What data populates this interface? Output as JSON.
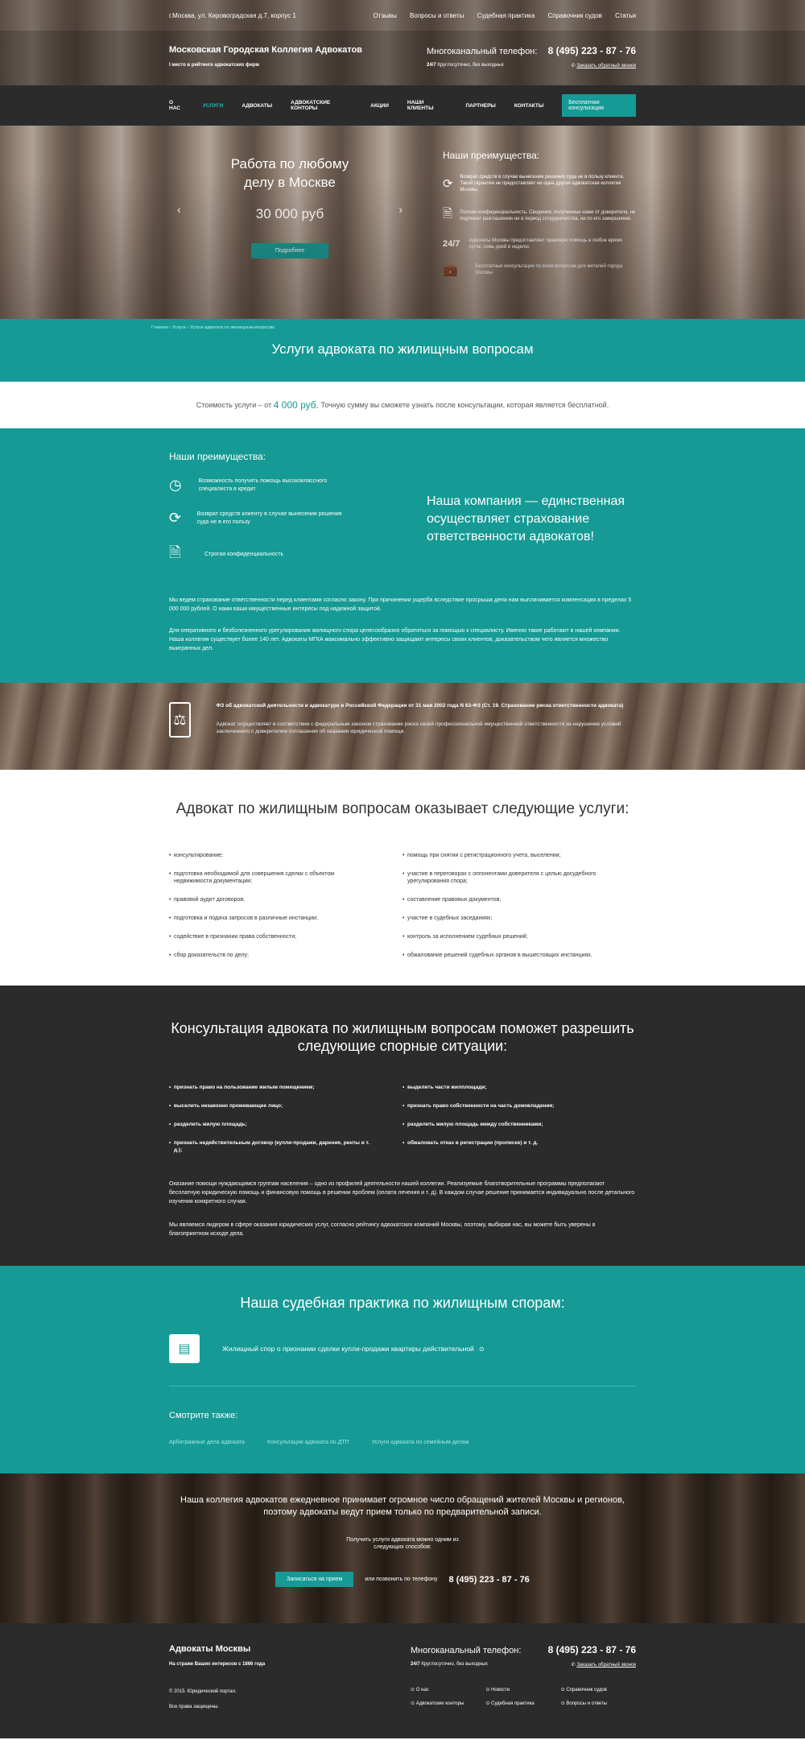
{
  "topbar": {
    "address": "г.Москва, ул. Кировоградская д.7, корпус 1",
    "links": [
      "Отзывы",
      "Вопросы и ответы",
      "Судебная практика",
      "Справочник судов",
      "Статьи"
    ]
  },
  "brand": {
    "title": "Московская Городская Коллегия Адвокатов",
    "subtitle": "I место в рейтинге адвокатских фирм",
    "phone_label": "Многоканальный телефон:",
    "phone": "8 (495) 223 - 87 - 76",
    "hours_bold": "24/7",
    "hours_text": "Круглосуточно, без выходных",
    "callback": "Заказать обратный звонок"
  },
  "nav": {
    "items": [
      "О НАС",
      "УСЛУГИ",
      "АДВОКАТЫ",
      "АДВОКАТСКИЕ КОНТОРЫ",
      "АКЦИИ",
      "НАШИ КЛИЕНТЫ",
      "ПАРТНЕРЫ",
      "КОНТАКТЫ"
    ],
    "cta": "Бесплатная консультация"
  },
  "hero": {
    "title": "Работа по любому делу в Москве",
    "price": "30 000 руб",
    "button": "Подробнее",
    "adv_title": "Наши преимущества:",
    "advantages": [
      {
        "icon": "refresh-icon",
        "text": "Возврат средств в случае вынесения решения суда не в пользу клиента. Такой гарантии не предоставляет ни одна другая адвокатская коллегия Москвы."
      },
      {
        "icon": "document-lock-icon",
        "text": "Полная конфиденциальность. Сведения, полученные нами от доверителя, не подлежат разглашению ни в период сотрудничества, ни по его завершению."
      },
      {
        "icon": "clock-24-7-icon",
        "text": "Адвокаты Москвы предоставляют правовую помощь в любое время суток, семь дней в неделю."
      },
      {
        "icon": "briefcase-icon",
        "text": "Бесплатные консультации по всем вопросам для жителей города Москвы"
      }
    ]
  },
  "page": {
    "breadcrumb": "Главная › Услуги › Услуги адвоката по жилищным вопросам",
    "title": "Услуги адвоката по жилищным вопросам",
    "cost_prefix": "Стоимость услуги – от",
    "cost_value": "4 000 руб.",
    "cost_suffix": "Точную сумму вы сможете узнать после консультации, которая является бесплатной."
  },
  "advbox": {
    "title": "Наши преимущества:",
    "items": [
      "Возможность получить помощь высококлассного специалиста в кредит",
      "Возврат средств клиенту в случае вынесения решения суда не в его пользу",
      "Строгая конфиденциальность"
    ],
    "claim": "Наша компания — единственная осуществляет страхование ответственности адвокатов!",
    "p1": "Мы ведем страхование ответственности перед клиентами согласно закону. При причинении ущерба вследствие просрыша дела нам выплачивается компенсация в пределах 5 000 000 рублей. О нами ваши имущественные интересы под надежной защитой.",
    "p2": "Для оперативного и безболезненного урегулирования жилищного спора целесообразно обратиться за помощью к специалисту. Именно такие работают в нашей компании. Наша коллегия существует более 140 лет. Адвокаты МГКА максимально эффективно защищают интересы своих клиентов, доказательством чего является множество выигранных дел."
  },
  "law": {
    "title": "ФЗ об адвокатской деятельности и адвокатуре в Российской Федерации от 31 мая 2002 года N 63-ФЗ (Ст. 19. Страхование риска ответственности адвоката)",
    "text": "Адвокат осуществляет в соответствии с федеральным законом страхование риска своей профессиональной имущественной ответственности за нарушение условий заключенного с доверителем соглашения об оказании юридической помощи."
  },
  "services": {
    "title": "Адвокат по жилищным вопросам оказывает следующие услуги:",
    "left": [
      "консультирование;",
      "подготовка необходимой для совершения сделки с объектом недвижимости документации;",
      "правовой аудит договоров;",
      "подготовка и подача запросов в различные инстанции;",
      "содействие в признании права собственности;",
      "сбор доказательств по делу;"
    ],
    "right": [
      "помощь при снятии с регистрационного учета, выселении;",
      "участие в переговорах с оппонентами доверителя с целью досудебного урегулирования спора;",
      "составление правовых документов;",
      "участие в судебных заседаниях;",
      "контроль за исполнением судебных решений;",
      "обжалование решений судебных органов в вышестоящих инстанциях."
    ]
  },
  "consult": {
    "title": "Консультация адвоката по жилищным вопросам поможет разрешить следующие спорные ситуации:",
    "left": [
      "признать право на пользование жилым помещением;",
      "выселить незаконно проживающее лицо;",
      "разделить жилую площадь;",
      "признать недействительным договор (купли-продажи, дарения, ренты и т. д.);"
    ],
    "right": [
      "выделить части жилплощади;",
      "признать право собственности на часть домовладения;",
      "разделить жилую площадь между собственниками;",
      "обжаловать отказ в регистрации (прописке) и т. д."
    ],
    "p1": "Оказание помощи нуждающимся группам населения – одно из профилей деятельности нашей коллегии. Реализуемые благотворительные программы предполагают бесплатную юридическую помощь и финансовую помощь в решении проблем (оплата лечения и т. д). В каждом случае решение принимается индивидуально после детального изучения конкретного случая.",
    "p2": "Мы являемся лидером в сфере оказания юридических услуг, согласно рейтингу адвокатских компаний Москвы, поэтому, выбирая нас, вы можете быть уверены в благоприятном исходе дела."
  },
  "practice": {
    "title": "Наша судебная практика по жилищным спорам:",
    "case": "Жилищный спор о признании сделки купли-продажи квартиры действительной",
    "see_also": "Смотрите также:",
    "links": [
      "Арбитражные дела адвоката",
      "Консультация адвоката по ДТП",
      "Услуги адвоката по семейным делам"
    ]
  },
  "appoint": {
    "title": "Наша коллегия адвокатов ежедневное принимает огромное число обращений жителей Москвы и регионов, поэтому адвокаты ведут прием только по предварительной записи.",
    "sub": "Получить услуги адвоката можно одним из следующих способов:",
    "button": "Записаться на прием",
    "or_call": "или позвонить по телефону",
    "phone": "8 (495) 223 - 87 - 76"
  },
  "footer": {
    "title": "Адвокаты Москвы",
    "subtitle": "На страже Ваших интересов с 1866 года",
    "copyright": "© 2015. Юридический портал.",
    "rights": "Все права защищены.",
    "phone_label": "Многоканальный телефон:",
    "phone": "8 (495) 223 - 87 - 76",
    "hours_bold": "24/7",
    "hours_text": "Круглосуточно, без выходных",
    "callback": "Заказать обратный звонок",
    "menu": [
      "О нас",
      "Новости",
      "Справочник судов",
      "Адвокатские конторы",
      "Судебная практика",
      "Вопросы и ответы"
    ]
  },
  "colors": {
    "teal": "#159a95",
    "dark": "#2b2b2b"
  }
}
